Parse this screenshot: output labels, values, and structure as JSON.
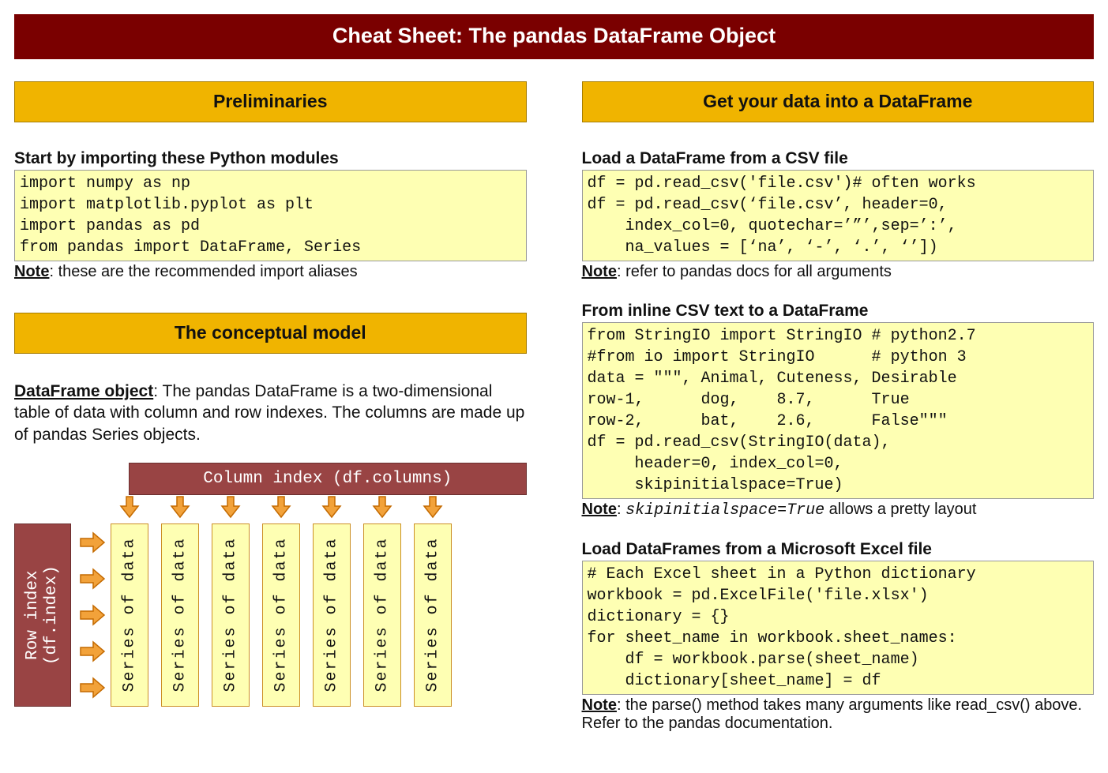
{
  "banner": "Cheat Sheet: The pandas DataFrame Object",
  "left": {
    "section1_title": "Preliminaries",
    "sub1": "Start by importing these Python modules",
    "code1": "import numpy as np\nimport matplotlib.pyplot as plt\nimport pandas as pd\nfrom pandas import DataFrame, Series",
    "note1_label": "Note",
    "note1_text": ": these are the recommended import aliases",
    "section2_title": "The conceptual model",
    "desc_label": "DataFrame object",
    "desc_text": ": The pandas DataFrame is a two-dimensional table of data with column and row indexes. The columns are made up of pandas Series objects.",
    "diagram": {
      "col_index": "Column index (df.columns)",
      "row_index_line1": "Row index",
      "row_index_line2": "(df.index)",
      "series_label": "Series of data",
      "series_count": 7,
      "row_arrow_count": 5
    }
  },
  "right": {
    "section_title": "Get your data into a DataFrame",
    "sub1": "Load a DataFrame from a CSV file",
    "code1": "df = pd.read_csv('file.csv')# often works\ndf = pd.read_csv(‘file.csv’, header=0,\n    index_col=0, quotechar=’”’,sep=’:’,\n    na_values = [‘na’, ‘-’, ‘.’, ‘’])",
    "note1_label": "Note",
    "note1_text": ": refer to pandas docs for all arguments",
    "sub2": "From inline CSV text to a DataFrame",
    "code2": "from StringIO import StringIO # python2.7\n#from io import StringIO      # python 3\ndata = \"\"\", Animal, Cuteness, Desirable\nrow-1,      dog,    8.7,      True\nrow-2,      bat,    2.6,      False\"\"\"\ndf = pd.read_csv(StringIO(data),\n     header=0, index_col=0,\n     skipinitialspace=True)",
    "note2_label": "Note",
    "note2_pre": ": ",
    "note2_code": "skipinitialspace=True",
    "note2_post": " allows a pretty layout",
    "sub3": "Load DataFrames from a Microsoft Excel file",
    "code3": "# Each Excel sheet in a Python dictionary\nworkbook = pd.ExcelFile('file.xlsx')\ndictionary = {}\nfor sheet_name in workbook.sheet_names:\n    df = workbook.parse(sheet_name)\n    dictionary[sheet_name] = df",
    "note3_label": "Note",
    "note3_text": ": the parse() method takes many arguments like read_csv() above. Refer to the pandas documentation."
  }
}
